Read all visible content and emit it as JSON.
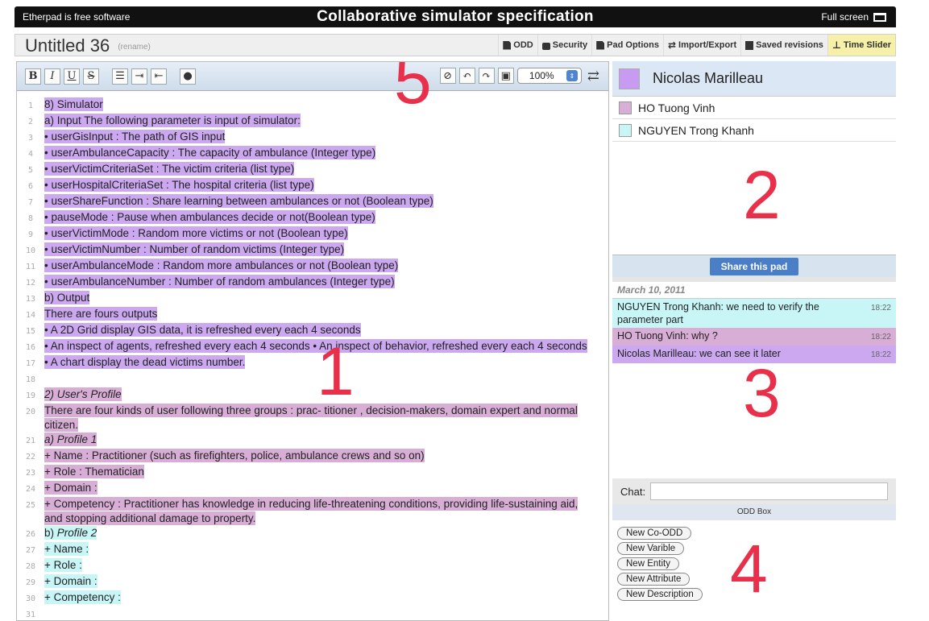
{
  "topbar": {
    "left_text": "Etherpad is free software",
    "title": "Collaborative simulator specification",
    "fullscreen": "Full screen"
  },
  "pad": {
    "name": "Untitled 36",
    "rename": "(rename)",
    "buttons": [
      "ODD",
      "Security",
      "Pad Options",
      "Import/Export",
      "Saved revisions",
      "Time Slider"
    ]
  },
  "editor_toolbar": {
    "bold": "B",
    "italic": "I",
    "underline": "U",
    "strike": "S",
    "zoom": "100%"
  },
  "lines": [
    {
      "n": "1",
      "spans": [
        {
          "t": "8) Simulator",
          "c": "purple"
        }
      ]
    },
    {
      "n": "2",
      "spans": [
        {
          "t": "a) Input The following parameter is input of simulator:",
          "c": "purple"
        }
      ]
    },
    {
      "n": "3",
      "spans": [
        {
          "t": "• userGisInput : The path of GIS input",
          "c": "purple"
        }
      ]
    },
    {
      "n": "4",
      "spans": [
        {
          "t": "• userAmbulanceCapacity : The capacity of ambulance (Integer type)",
          "c": "purple"
        }
      ]
    },
    {
      "n": "5",
      "spans": [
        {
          "t": "• userVictimCriteriaSet : The victim criteria (list type)",
          "c": "purple"
        }
      ]
    },
    {
      "n": "6",
      "spans": [
        {
          "t": "• userHospitalCriteriaSet : The hospital criteria (list type)",
          "c": "purple"
        }
      ]
    },
    {
      "n": "7",
      "spans": [
        {
          "t": "• userShareFunction : Share learning between ambulances or not (Boolean type)",
          "c": "purple"
        }
      ]
    },
    {
      "n": "8",
      "spans": [
        {
          "t": "• pauseMode : Pause when ambulances decide or not(Boolean type)",
          "c": "purple"
        }
      ]
    },
    {
      "n": "9",
      "spans": [
        {
          "t": "• userVictimMode : Random more victims or not (Boolean type)",
          "c": "purple"
        }
      ]
    },
    {
      "n": "10",
      "spans": [
        {
          "t": "• userVictimNumber : Number of random victims (Integer type)",
          "c": "purple"
        }
      ]
    },
    {
      "n": "11",
      "spans": [
        {
          "t": "• userAmbulanceMode : Random more ambulances or not (Boolean type)",
          "c": "purple"
        }
      ]
    },
    {
      "n": "12",
      "spans": [
        {
          "t": "• userAmbulanceNumber : Number of random ambulances (Integer type)",
          "c": "purple"
        }
      ]
    },
    {
      "n": "13",
      "spans": [
        {
          "t": "b) Output",
          "c": "purple"
        }
      ]
    },
    {
      "n": "14",
      "spans": [
        {
          "t": "There are fours outputs",
          "c": "purple"
        }
      ]
    },
    {
      "n": "15",
      "spans": [
        {
          "t": "•    A 2D Grid display GIS data, it is refreshed every each 4 seconds",
          "c": "purple"
        }
      ]
    },
    {
      "n": "16",
      "spans": [
        {
          "t": "•    An inspect of agents, refreshed every each 4 seconds •    An inspect of behavior, refreshed every each 4 seconds",
          "c": "purple"
        }
      ]
    },
    {
      "n": "17",
      "spans": [
        {
          "t": "•    A chart display the dead victims number.",
          "c": "purple"
        }
      ]
    },
    {
      "n": "18",
      "spans": []
    },
    {
      "n": "19",
      "spans": [
        {
          "t": "2) User's Profile",
          "c": "pink",
          "i": true
        }
      ]
    },
    {
      "n": "20",
      "spans": [
        {
          "t": "There are four kinds of user following three groups : prac- titioner , decision-makers, domain expert and normal citizen.",
          "c": "pink"
        }
      ]
    },
    {
      "n": "21",
      "spans": [
        {
          "t": "a) Profile 1",
          "c": "pink",
          "i": true
        }
      ]
    },
    {
      "n": "22",
      "spans": [
        {
          "t": "+ Name : Practitioner (such as firefighters, police, ambulance crews and so on)",
          "c": "pink"
        }
      ]
    },
    {
      "n": "23",
      "spans": [
        {
          "t": "+ Role : Thematician",
          "c": "pink"
        }
      ]
    },
    {
      "n": "24",
      "spans": [
        {
          "t": "+ Domain :",
          "c": "pink"
        }
      ]
    },
    {
      "n": "25",
      "spans": [
        {
          "t": "+ Competency : Practitioner has knowledge in reducing life-threatening conditions, providing life-sustaining aid, and stopping additional damage to property.",
          "c": "pink"
        }
      ]
    },
    {
      "n": "26",
      "spans": [
        {
          "t": "b)  ",
          "c": "cyan"
        },
        {
          "t": "Profile 2",
          "c": "cyan",
          "i": true
        }
      ]
    },
    {
      "n": "27",
      "spans": [
        {
          "t": "+ Name :",
          "c": "cyan"
        }
      ]
    },
    {
      "n": "28",
      "spans": [
        {
          "t": "+ Role :",
          "c": "cyan"
        }
      ]
    },
    {
      "n": "29",
      "spans": [
        {
          "t": "+ Domain :",
          "c": "cyan"
        }
      ]
    },
    {
      "n": "30",
      "spans": [
        {
          "t": "+ Competency :",
          "c": "cyan"
        }
      ]
    },
    {
      "n": "31",
      "spans": []
    }
  ],
  "colors": {
    "purple": "#cba8f0",
    "pink": "#d9aed6",
    "cyan": "#c8f6f7"
  },
  "users": {
    "self": {
      "name": "Nicolas Marilleau",
      "color": "#c89bf2"
    },
    "others": [
      {
        "name": "HO Tuong Vinh",
        "color": "#d9aed6"
      },
      {
        "name": "NGUYEN Trong Khanh",
        "color": "#c8f6f7"
      }
    ],
    "share_label": "Share this pad"
  },
  "chat": {
    "date": "March 10, 2011",
    "messages": [
      {
        "text": "NGUYEN Trong Khanh: we need to verify the parameter part",
        "time": "18:22",
        "color": "#c8f6f7"
      },
      {
        "text": "HO Tuong Vinh: why ?",
        "time": "18:22",
        "color": "#d9aed6"
      },
      {
        "text": "Nicolas Marilleau: we can see it later",
        "time": "18:22",
        "color": "#cba8f0"
      }
    ],
    "input_label": "Chat:"
  },
  "odd_box": {
    "title": "ODD Box",
    "buttons": [
      "New Co-ODD",
      "New Varible",
      "New Entity",
      "New Attribute",
      "New Description"
    ]
  },
  "annotations": [
    "1",
    "2",
    "3",
    "4",
    "5"
  ]
}
